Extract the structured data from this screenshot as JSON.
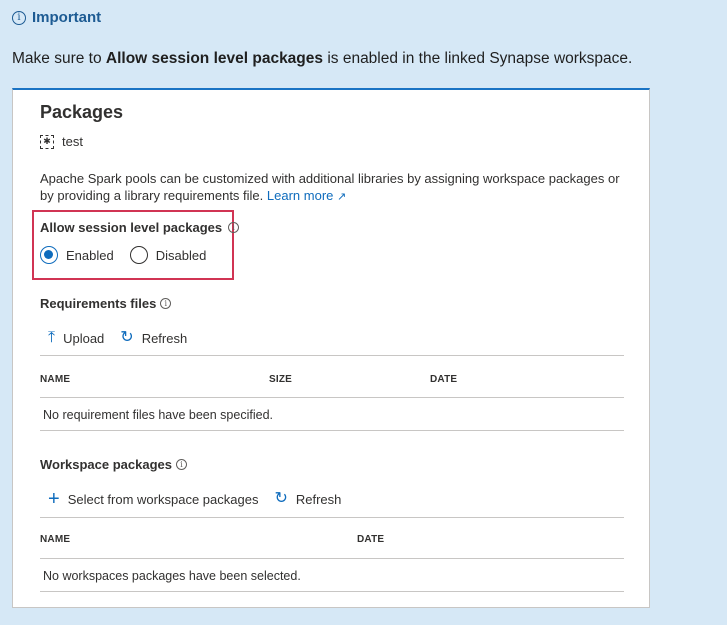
{
  "callout": {
    "heading": "Important",
    "text_before": "Make sure to ",
    "text_bold": "Allow session level packages",
    "text_after": " is enabled in the linked Synapse workspace."
  },
  "panel": {
    "title": "Packages",
    "pool_name": "test",
    "description": "Apache Spark pools can be customized with additional libraries by assigning workspace packages or by providing a library requirements file.",
    "learn_more": "Learn more",
    "session_packages": {
      "label": "Allow session level packages",
      "options": [
        "Enabled",
        "Disabled"
      ],
      "selected": "Enabled"
    },
    "requirements": {
      "label": "Requirements files",
      "upload_label": "Upload",
      "refresh_label": "Refresh",
      "columns": [
        "NAME",
        "SIZE",
        "DATE"
      ],
      "empty_message": "No requirement files have been specified."
    },
    "workspace": {
      "label": "Workspace packages",
      "select_label": "Select from workspace packages",
      "refresh_label": "Refresh",
      "columns": [
        "NAME",
        "DATE"
      ],
      "empty_message": "No workspaces packages have been selected."
    }
  },
  "colors": {
    "background": "#d6e8f6",
    "accent": "#0f6cbd",
    "highlight_border": "#d13453",
    "callout_heading": "#1d5b93"
  }
}
